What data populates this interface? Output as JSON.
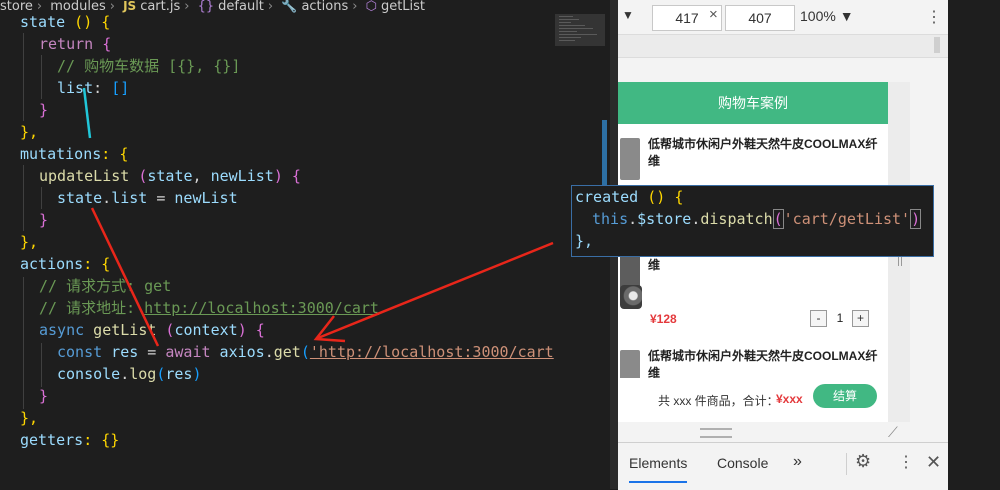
{
  "breadcrumb": {
    "items": [
      "store",
      "modules",
      "cart.js",
      "default",
      "actions",
      "getList"
    ],
    "js_badge": "JS",
    "separator": "›"
  },
  "code": {
    "l1": {
      "a": "state",
      "b": " () {"
    },
    "l2": {
      "a": "return",
      "b": " {"
    },
    "l3": "// 购物车数据 [{}, {}]",
    "l4": {
      "a": "list",
      "b": ": ",
      "c": "[]"
    },
    "l5": "}",
    "l6": "},",
    "l7": {
      "a": "mutations",
      "b": ": {"
    },
    "l8": {
      "a": "updateList",
      "b": " (",
      "c": "state",
      "d": ", ",
      "e": "newList",
      "f": ") {"
    },
    "l9": {
      "a": "state",
      "b": ".",
      "c": "list",
      "d": " = ",
      "e": "newList"
    },
    "l10": "}",
    "l11": "},",
    "l12": {
      "a": "actions",
      "b": ": {"
    },
    "l13": "// 请求方式: get",
    "l14": {
      "a": "// 请求地址: ",
      "b": "http://localhost:3000/cart"
    },
    "l15": {
      "a": "async",
      "b": " getList",
      "c": " (",
      "d": "context",
      "e": ") {"
    },
    "l16": {
      "a": "const",
      "b": " res",
      "c": " = ",
      "d": "await",
      "e": " axios",
      "f": ".",
      "g": "get",
      "h": "(",
      "i": "'http://localhost:3000/cart"
    },
    "l17": {
      "a": "console",
      "b": ".",
      "c": "log",
      "d": "(",
      "e": "res",
      "f": ")"
    },
    "l18": "}",
    "l19": "},",
    "l20": {
      "a": "getters",
      "b": ": {}"
    }
  },
  "popup": {
    "l1": {
      "a": "created",
      "b": " () {"
    },
    "l2": {
      "a": "this",
      "b": ".",
      "c": "$store",
      "d": ".",
      "e": "dispatch",
      "f": "(",
      "g": "'cart/getList'",
      "h": ")"
    },
    "l3": "},"
  },
  "devtools": {
    "width": "417",
    "height": "407",
    "times": "×",
    "zoom": "100% ▼",
    "menu_glyph": "⋮",
    "tabs": [
      "Elements",
      "Console"
    ],
    "more_glyph": "»",
    "gear_glyph": "⚙",
    "kebab_glyph": "⋮",
    "close_glyph": "✕"
  },
  "app": {
    "header": "购物车案例",
    "products": [
      {
        "title": "低帮城市休闲户外鞋天然牛皮COOLMAX纤维"
      },
      {
        "title": "维",
        "price": "¥128",
        "qty": "1"
      },
      {
        "title": "低帮城市休闲户外鞋天然牛皮COOLMAX纤维"
      }
    ],
    "minus": "-",
    "plus": "+",
    "footer_text": "共 xxx 件商品，合计：",
    "footer_total": "¥xxx",
    "checkout": "结算"
  },
  "colors": {
    "accent_green": "#41b883",
    "price_red": "#e4393c",
    "arrow_red": "#e8261a",
    "cursor_cyan": "#21c7d9"
  }
}
